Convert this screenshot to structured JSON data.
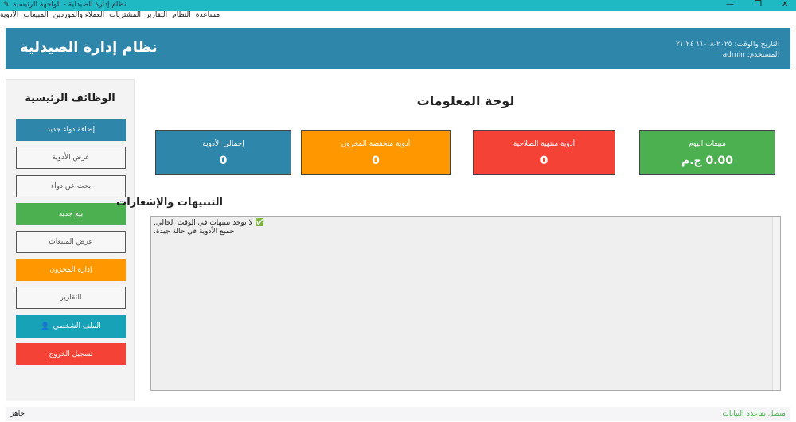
{
  "window": {
    "title": "نظام إدارة الصيدلية - الواجهة الرئيسية",
    "minimize": "—",
    "restore": "❐",
    "close": "✕"
  },
  "menu": [
    "مساعدة",
    "النظام",
    "التقارير",
    "المشتريات",
    "العملاء والموردين",
    "المبيعات",
    "الأدوية"
  ],
  "header": {
    "title": "نظام إدارة الصيدلية",
    "datetime": "التاريخ والوقت: ٢٠٢٥-٠٨-١١ ٢١:٢٤",
    "user": "المستخدم: admin"
  },
  "sidebar": {
    "title": "الوظائف الرئيسية",
    "buttons": [
      {
        "label": "إضافة دواء جديد",
        "color": "#2e86ab"
      },
      {
        "label": "عرض الأدوية",
        "color": "white"
      },
      {
        "label": "بحث عن دواء",
        "color": "white"
      },
      {
        "label": "بيع جديد",
        "color": "#4caf50"
      },
      {
        "label": "عرض المبيعات",
        "color": "white"
      },
      {
        "label": "إدارة المخزون",
        "color": "#ff9800"
      },
      {
        "label": "التقارير",
        "color": "white"
      },
      {
        "label": "الملف الشخصي",
        "color": "#17a2b8"
      },
      {
        "label": "تسجيل الخروج",
        "color": "#f44336"
      }
    ]
  },
  "dashboard": {
    "title": "لوحة المعلومات",
    "cards": [
      {
        "label": "إجمالي الأدوية",
        "value": "0",
        "color": "#2e86ab"
      },
      {
        "label": "أدوية منخفضة المخزون",
        "value": "0",
        "color": "#ff9800"
      },
      {
        "label": "أدوية منتهية الصلاحية",
        "value": "0",
        "color": "#f44336"
      },
      {
        "label": "مبيعات اليوم",
        "value": "0.00 ج.م",
        "color": "#4caf50"
      }
    ]
  },
  "alerts": {
    "title": "التنبيهات والإشعارات",
    "lines": [
      "✅ لا توجد تنبيهات في الوقت الحالي.",
      "جميع الأدوية في حالة جيدة."
    ]
  },
  "status": {
    "left": "جاهز",
    "right": "متصل بقاعدة البيانات"
  }
}
